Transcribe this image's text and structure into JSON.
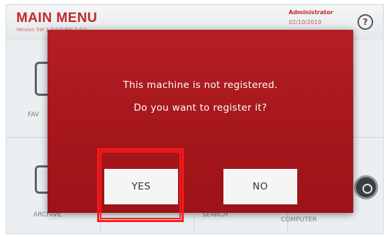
{
  "header": {
    "title": "MAIN MENU",
    "version": "Version SW 1.0.0.0 FW 2.0.0",
    "user": "Administrator",
    "date": "02/10/2019",
    "help_label": "?"
  },
  "tiles": [
    {
      "label": "FAV"
    },
    {
      "label": "ARCHIVE"
    },
    {
      "label": "SEARCH"
    },
    {
      "label": "COMPUTER"
    }
  ],
  "dialog": {
    "message_line1": "This machine is not registered.",
    "message_line2": "Do you want to register it?",
    "yes_label": "YES",
    "no_label": "NO"
  },
  "colors": {
    "accent": "#c2272d",
    "dialog_bg": "#a8181d",
    "highlight": "#ff1a1a"
  }
}
